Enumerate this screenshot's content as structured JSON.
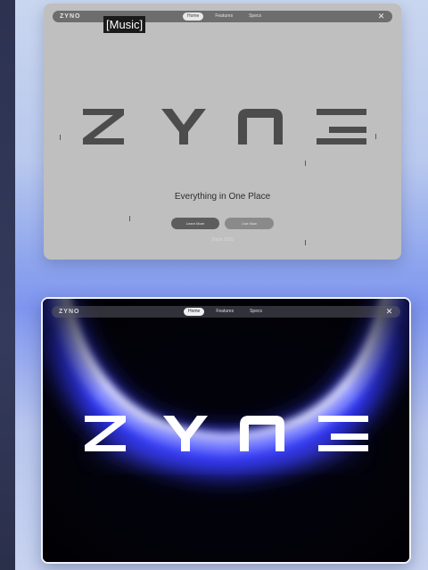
{
  "caption": "[Music]",
  "top_preview": {
    "logo": "ZYNO",
    "nav": {
      "links": [
        "Home",
        "Features",
        "Specs"
      ],
      "close_icon": "x-icon"
    },
    "headline_word": "ZYNO",
    "tagline": "Everything in One Place",
    "buttons": [
      "Learn More",
      "Live Now"
    ],
    "subline": "Ships 2025"
  },
  "bottom_preview": {
    "logo": "ZYNO",
    "nav": {
      "links": [
        "Home",
        "Features",
        "Specs"
      ],
      "close_icon": "x-icon"
    },
    "headline_word": "ZYNO"
  },
  "colors": {
    "wireframe": "#bfbfbf",
    "glow": "#3a3ff0",
    "background": "#9fb2ee"
  }
}
